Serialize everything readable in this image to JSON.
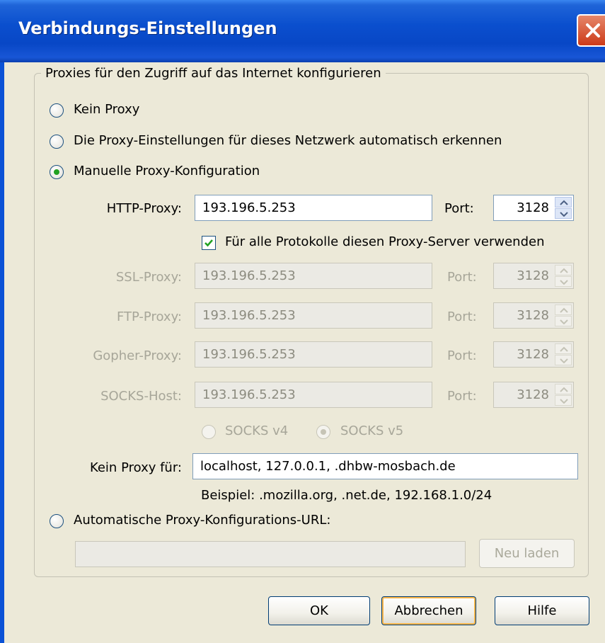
{
  "window": {
    "title": "Verbindungs-Einstellungen",
    "close_icon": "close-x-icon"
  },
  "group_title": "Proxies für den Zugriff auf das Internet konfigurieren",
  "options": {
    "no_proxy": {
      "label": "Kein Proxy",
      "selected": false
    },
    "auto_detect": {
      "label": "Die Proxy-Einstellungen für dieses Netzwerk automatisch erkennen",
      "selected": false
    },
    "manual": {
      "label": "Manuelle Proxy-Konfiguration",
      "selected": true
    },
    "auto_url": {
      "label": "Automatische Proxy-Konfigurations-URL:",
      "selected": false
    }
  },
  "http": {
    "label": "HTTP-Proxy:",
    "value": "193.196.5.253",
    "port_label": "Port:",
    "port": "3128"
  },
  "use_all": {
    "label": "Für alle Protokolle diesen Proxy-Server verwenden",
    "checked": true
  },
  "ssl": {
    "label": "SSL-Proxy:",
    "value": "193.196.5.253",
    "port_label": "Port:",
    "port": "3128"
  },
  "ftp": {
    "label": "FTP-Proxy:",
    "value": "193.196.5.253",
    "port_label": "Port:",
    "port": "3128"
  },
  "gopher": {
    "label": "Gopher-Proxy:",
    "value": "193.196.5.253",
    "port_label": "Port:",
    "port": "3128"
  },
  "socks": {
    "label": "SOCKS-Host:",
    "value": "193.196.5.253",
    "port_label": "Port:",
    "port": "3128"
  },
  "socks_versions": {
    "v4": "SOCKS v4",
    "v5": "SOCKS v5",
    "selected": "v5"
  },
  "no_proxy_for": {
    "label": "Kein Proxy für:",
    "value": "localhost, 127.0.0.1, .dhbw-mosbach.de",
    "example": "Beispiel: .mozilla.org, .net.de, 192.168.1.0/24"
  },
  "auto_url": {
    "value": "",
    "reload_label": "Neu laden"
  },
  "buttons": {
    "ok": "OK",
    "cancel": "Abbrechen",
    "help": "Hilfe"
  },
  "colors": {
    "title_bar": "#0a4fce",
    "dialog_bg": "#ece9d8",
    "radio_dot": "#21a121",
    "close_red": "#cc3a18"
  }
}
